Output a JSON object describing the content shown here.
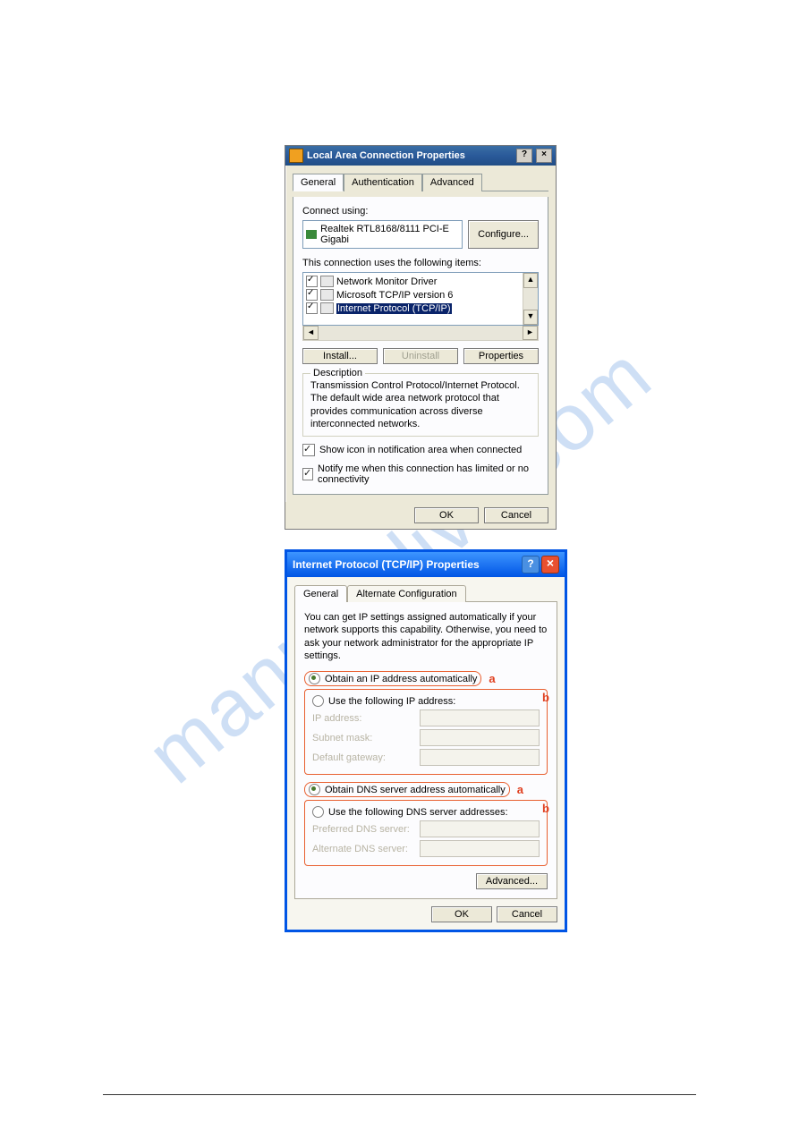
{
  "watermark": "manualslive.com",
  "dialog1": {
    "title": "Local Area Connection Properties",
    "help_btn": "?",
    "close_btn": "×",
    "tabs": [
      "General",
      "Authentication",
      "Advanced"
    ],
    "connect_using_label": "Connect using:",
    "adapter": "Realtek RTL8168/8111 PCI-E Gigabi",
    "configure_btn": "Configure...",
    "items_label": "This connection uses the following items:",
    "items": [
      {
        "label": "Network Monitor Driver"
      },
      {
        "label": "Microsoft TCP/IP version 6"
      },
      {
        "label": "Internet Protocol (TCP/IP)",
        "selected": true
      }
    ],
    "install_btn": "Install...",
    "uninstall_btn": "Uninstall",
    "properties_btn": "Properties",
    "description_legend": "Description",
    "description_text": "Transmission Control Protocol/Internet Protocol. The default wide area network protocol that provides communication across diverse interconnected networks.",
    "show_icon": "Show icon in notification area when connected",
    "notify_limited": "Notify me when this connection has limited or no connectivity",
    "ok_btn": "OK",
    "cancel_btn": "Cancel"
  },
  "dialog2": {
    "title": "Internet Protocol (TCP/IP) Properties",
    "tabs": [
      "General",
      "Alternate Configuration"
    ],
    "intro": "You can get IP settings assigned automatically if your network supports this capability. Otherwise, you need to ask your network administrator for the appropriate IP settings.",
    "radio_auto_ip": "Obtain an IP address automatically",
    "radio_use_ip": "Use the following IP address:",
    "field_ip": "IP address:",
    "field_subnet": "Subnet mask:",
    "field_gateway": "Default gateway:",
    "radio_auto_dns": "Obtain DNS server address automatically",
    "radio_use_dns": "Use the following DNS server addresses:",
    "field_pref_dns": "Preferred DNS server:",
    "field_alt_dns": "Alternate DNS server:",
    "advanced_btn": "Advanced...",
    "ok_btn": "OK",
    "cancel_btn": "Cancel",
    "ann_a": "a",
    "ann_b": "b"
  }
}
